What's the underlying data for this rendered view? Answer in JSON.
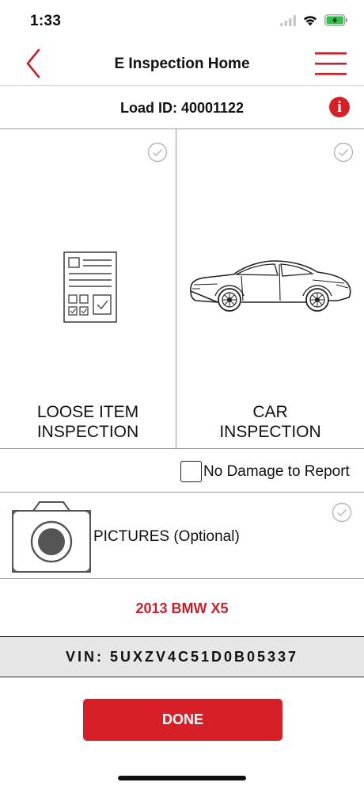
{
  "status_bar": {
    "time": "1:33",
    "icons": [
      "signal-icon",
      "wifi-icon",
      "battery-charging-icon"
    ],
    "battery_color": "#2fc24a"
  },
  "nav": {
    "title": "E Inspection Home",
    "back_icon": "chevron-left-icon",
    "menu_icon": "hamburger-menu-icon"
  },
  "load": {
    "label": "Load ID: 40001122",
    "info_icon": "info-icon",
    "info_glyph": "i"
  },
  "tiles": [
    {
      "line1": "LOOSE ITEM",
      "line2": "INSPECTION",
      "icon": "checklist-document-icon",
      "check_icon": "check-circle-icon"
    },
    {
      "line1": "CAR",
      "line2": "INSPECTION",
      "icon": "sedan-car-icon",
      "check_icon": "check-circle-icon"
    }
  ],
  "no_damage": {
    "label": "No Damage to Report",
    "checked": false
  },
  "pictures": {
    "label": "PICTURES (Optional)",
    "icon": "camera-icon",
    "check_icon": "check-circle-icon"
  },
  "vehicle": {
    "name": "2013 BMW X5"
  },
  "vin": {
    "label": "VIN: 5UXZV4C51D0B05337"
  },
  "done_button": {
    "label": "DONE"
  },
  "colors": {
    "accent": "#d71f27",
    "vehicle_text": "#c8202a",
    "vin_background": "#e6e6e6",
    "divider": "#9a9a9a"
  }
}
